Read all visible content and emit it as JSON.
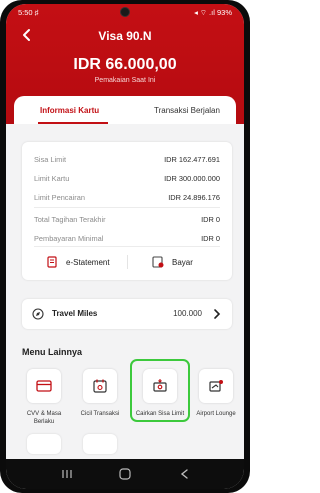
{
  "status_bar": {
    "time": "5:50 ♯",
    "right": "◂ ⌔ .ıl 93%"
  },
  "header": {
    "title": "Visa 90.N",
    "amount": "IDR 66.000,00",
    "amount_label": "Pemakaian Saat Ini"
  },
  "tabs": [
    {
      "label": "Informasi Kartu"
    },
    {
      "label": "Transaksi Berjalan"
    }
  ],
  "card_info": {
    "rows": [
      {
        "label": "Sisa Limit",
        "value": "IDR 162.477.691"
      },
      {
        "label": "Limit Kartu",
        "value": "IDR 300.000.000"
      },
      {
        "label": "Limit Pencairan",
        "value": "IDR 24.896.176"
      },
      {
        "label": "Total Tagihan Terakhir",
        "value": "IDR 0"
      },
      {
        "label": "Pembayaran Minimal",
        "value": "IDR 0"
      }
    ],
    "estatement_label": "e-Statement",
    "pay_label": "Bayar"
  },
  "travel_miles": {
    "label": "Travel Miles",
    "value": "100.000"
  },
  "menu": {
    "title": "Menu Lainnya",
    "items": [
      {
        "label": "CVV & Masa Berlaku",
        "icon": "card-icon"
      },
      {
        "label": "Cicil Transaksi",
        "icon": "calendar-icon"
      },
      {
        "label": "Cairkan Sisa Limit",
        "icon": "cash-icon"
      },
      {
        "label": "Airport Lounge",
        "icon": "lounge-icon"
      }
    ]
  },
  "colors": {
    "brand": "#c20f14",
    "highlight": "#3cc93c"
  }
}
